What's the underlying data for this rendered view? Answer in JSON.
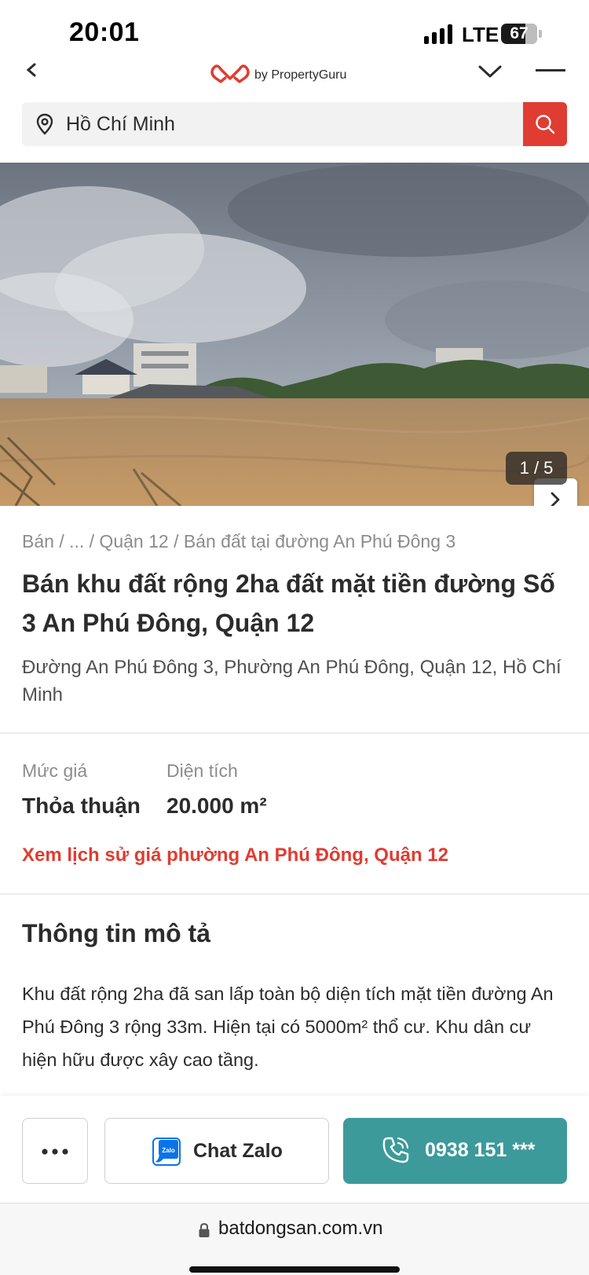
{
  "status_bar": {
    "time": "20:01",
    "network": "LTE",
    "battery": "67",
    "battery_level_percent": 67
  },
  "header": {
    "logo_text": "by PropertyGuru",
    "brand_color": "#e03c31",
    "icons": [
      "back-icon",
      "chevron-down-icon",
      "menu-icon"
    ]
  },
  "search": {
    "value": "Hồ Chí Minh",
    "button_color": "#e03c31"
  },
  "gallery": {
    "counter": "1 / 5",
    "current": 1,
    "total": 5
  },
  "listing": {
    "breadcrumb": "Bán / ... / Quận 12 / Bán đất tại đường An Phú Đông 3",
    "title": "Bán khu đất rộng 2ha đất mặt tiền đường Số 3 An Phú Đông, Quận 12",
    "address": "Đường An Phú Đông 3, Phường An Phú Đông, Quận 12, Hồ Chí Minh",
    "price_label": "Mức giá",
    "price_value": "Thỏa thuận",
    "area_label": "Diện tích",
    "area_value": "20.000 m²",
    "history_link": "Xem lịch sử giá phường An Phú Đông, Quận 12",
    "description_title": "Thông tin mô tả",
    "description": "Khu đất rộng 2ha đã san lấp toàn bộ diện tích mặt tiền đường An Phú Đông 3 rộng 33m. Hiện tại có 5000m² thổ cư. Khu dân cư hiện hữu được xây cao tầng."
  },
  "actions": {
    "zalo_label": "Chat Zalo",
    "phone_label": "0938 151 ***",
    "phone_color": "#3c9a9b"
  },
  "browser": {
    "url": "batdongsan.com.vn"
  }
}
